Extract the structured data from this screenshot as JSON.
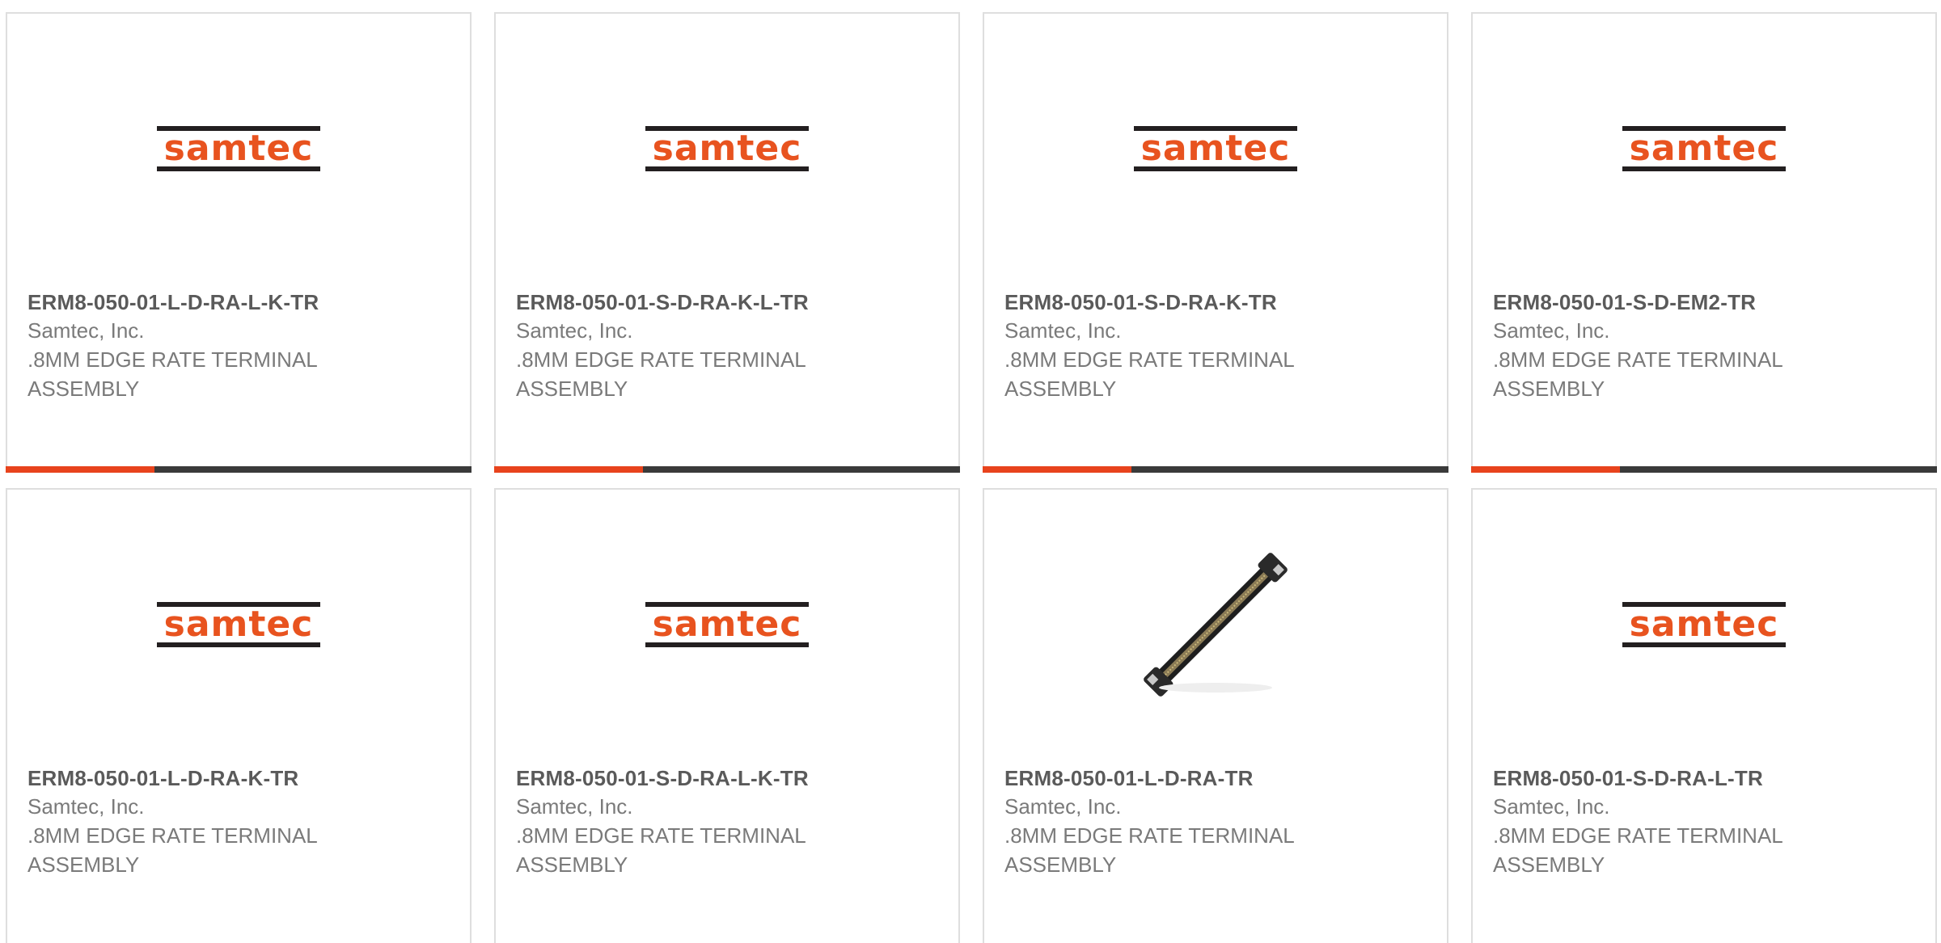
{
  "logo_text": "samtec",
  "colors": {
    "brand_orange": "#e8531f",
    "accent_orange": "#e8431c",
    "accent_dark": "#3a3a3a",
    "border": "#dedede"
  },
  "products": [
    {
      "part": "ERM8-050-01-L-D-RA-L-K-TR",
      "manufacturer": "Samtec, Inc.",
      "description": ".8MM EDGE RATE TERMINAL ASSEMBLY",
      "image": "samtec-logo"
    },
    {
      "part": "ERM8-050-01-S-D-RA-K-L-TR",
      "manufacturer": "Samtec, Inc.",
      "description": ".8MM EDGE RATE TERMINAL ASSEMBLY",
      "image": "samtec-logo"
    },
    {
      "part": "ERM8-050-01-S-D-RA-K-TR",
      "manufacturer": "Samtec, Inc.",
      "description": ".8MM EDGE RATE TERMINAL ASSEMBLY",
      "image": "samtec-logo"
    },
    {
      "part": "ERM8-050-01-S-D-EM2-TR",
      "manufacturer": "Samtec, Inc.",
      "description": ".8MM EDGE RATE TERMINAL ASSEMBLY",
      "image": "samtec-logo"
    },
    {
      "part": "ERM8-050-01-L-D-RA-K-TR",
      "manufacturer": "Samtec, Inc.",
      "description": ".8MM EDGE RATE TERMINAL ASSEMBLY",
      "image": "samtec-logo"
    },
    {
      "part": "ERM8-050-01-S-D-RA-L-K-TR",
      "manufacturer": "Samtec, Inc.",
      "description": ".8MM EDGE RATE TERMINAL ASSEMBLY",
      "image": "samtec-logo"
    },
    {
      "part": "ERM8-050-01-L-D-RA-TR",
      "manufacturer": "Samtec, Inc.",
      "description": ".8MM EDGE RATE TERMINAL ASSEMBLY",
      "image": "connector-photo"
    },
    {
      "part": "ERM8-050-01-S-D-RA-L-TR",
      "manufacturer": "Samtec, Inc.",
      "description": ".8MM EDGE RATE TERMINAL ASSEMBLY",
      "image": "samtec-logo"
    }
  ]
}
